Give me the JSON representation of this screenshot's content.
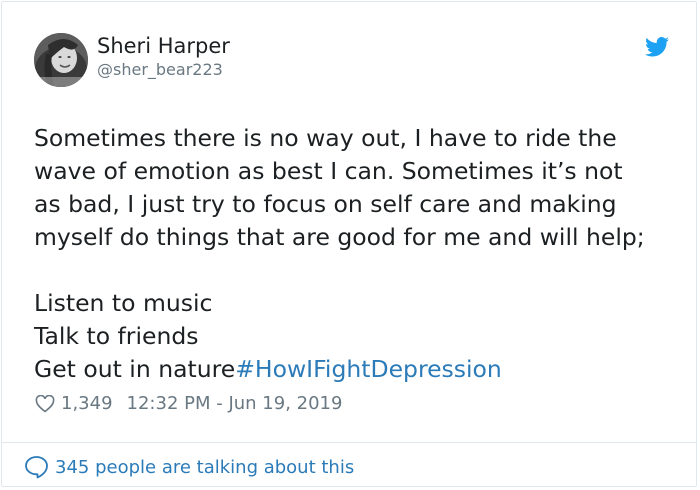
{
  "author": {
    "display_name": "Sheri Harper",
    "handle": "@sher_bear223"
  },
  "icons": {
    "avatar": "profile-photo",
    "logo": "twitter-bird-icon",
    "like": "heart-outline-icon",
    "reply": "speech-bubble-icon"
  },
  "tweet": {
    "lines": [
      "Sometimes there is no way out, I have to ride the",
      "wave of emotion as best I can.  Sometimes it’s not",
      "as bad, I just try to focus on self care and making",
      "myself do things that are good for me and will help;"
    ],
    "list": [
      "Listen to music",
      "Talk to friends"
    ],
    "last_line_text": "Get out in nature",
    "hashtag": "#HowIFightDepression"
  },
  "meta": {
    "likes": "1,349",
    "timestamp": "12:32 PM - Jun 19, 2019"
  },
  "footer": {
    "talking_text": "345 people are talking about this"
  },
  "colors": {
    "accent": "#2b7bb9",
    "twitter_blue": "#1da1f2",
    "text": "#1c2022",
    "muted": "#697882",
    "border": "#e1e8ed"
  }
}
